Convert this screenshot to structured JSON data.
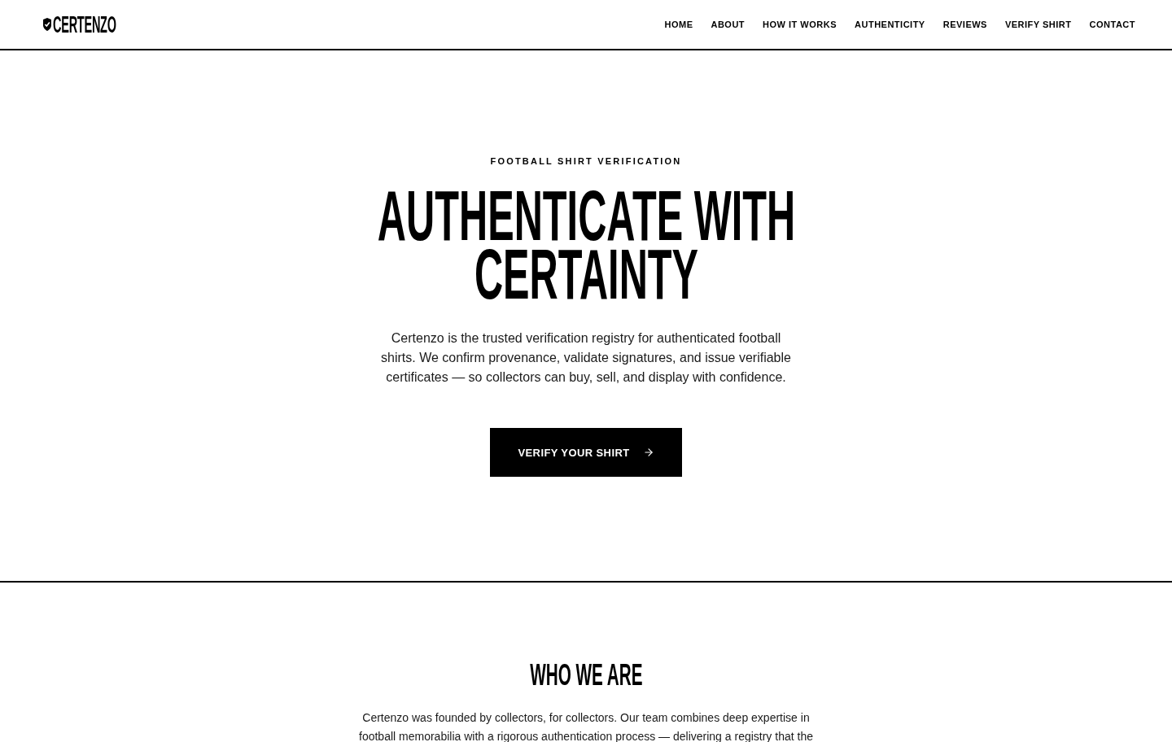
{
  "header": {
    "logo": "CERTENZO",
    "nav": [
      "HOME",
      "ABOUT",
      "HOW IT WORKS",
      "AUTHENTICITY",
      "REVIEWS",
      "VERIFY SHIRT",
      "CONTACT"
    ]
  },
  "hero": {
    "eyebrow": "FOOTBALL SHIRT VERIFICATION",
    "title": "AUTHENTICATE WITH CERTAINTY",
    "text": "Certenzo is the trusted verification registry for authenticated football shirts. We confirm provenance, validate signatures, and issue verifiable certificates — so collectors can buy, sell, and display with confidence.",
    "button": "VERIFY YOUR SHIRT"
  },
  "about": {
    "title": "WHO WE ARE",
    "text": "Certenzo was founded by collectors, for collectors. Our team combines deep expertise in football memorabilia with a rigorous authentication process — delivering a registry that the"
  }
}
